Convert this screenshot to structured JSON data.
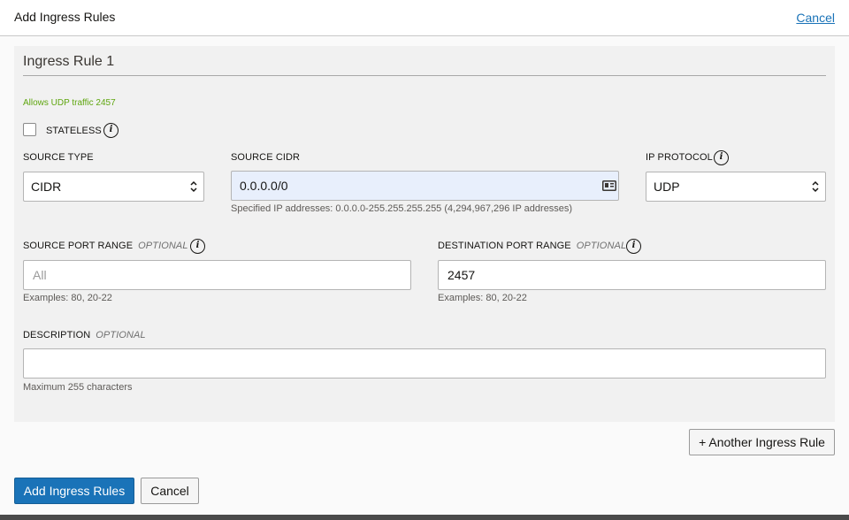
{
  "header": {
    "title": "Add Ingress Rules",
    "cancel_link": "Cancel"
  },
  "rule": {
    "title": "Ingress Rule 1",
    "description_hint": "Allows UDP traffic 2457",
    "stateless": {
      "label": "STATELESS",
      "checked": false
    },
    "source_type": {
      "label": "SOURCE TYPE",
      "value": "CIDR"
    },
    "source_cidr": {
      "label": "SOURCE CIDR",
      "value": "0.0.0.0/0",
      "helper": "Specified IP addresses: 0.0.0.0-255.255.255.255 (4,294,967,296 IP addresses)"
    },
    "ip_protocol": {
      "label": "IP PROTOCOL",
      "value": "UDP"
    },
    "source_port_range": {
      "label": "SOURCE PORT RANGE",
      "optional": "OPTIONAL",
      "value": "",
      "placeholder": "All",
      "helper": "Examples: 80, 20-22"
    },
    "destination_port_range": {
      "label": "DESTINATION PORT RANGE",
      "optional": "OPTIONAL",
      "value": "2457",
      "helper": "Examples: 80, 20-22"
    },
    "description": {
      "label": "DESCRIPTION",
      "optional": "OPTIONAL",
      "value": "",
      "helper": "Maximum 255 characters"
    }
  },
  "actions": {
    "another_rule": "+ Another Ingress Rule",
    "submit": "Add Ingress Rules",
    "cancel": "Cancel"
  },
  "colors": {
    "primary": "#1a73b8",
    "hint_green": "#5fa60f",
    "panel_bg": "#f1f1f1",
    "cidr_field_bg": "#e8effc"
  },
  "icons": {
    "info": "info-icon",
    "select": "select-arrows-icon",
    "cidr": "id-card-icon"
  }
}
